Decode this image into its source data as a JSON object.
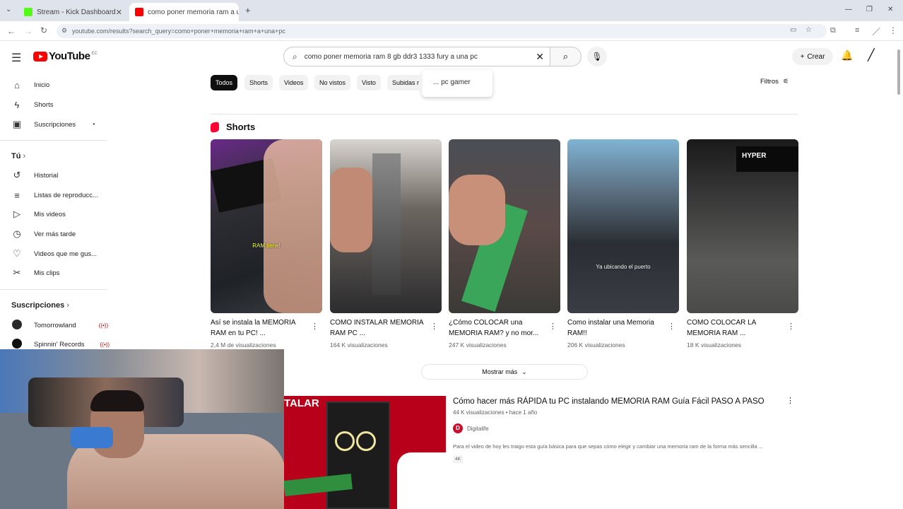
{
  "browser": {
    "tabs": [
      {
        "label": "Stream - Kick Dashboard",
        "active": false
      },
      {
        "label": "como poner memoria ram a u...",
        "active": true
      }
    ],
    "new_tab": "+",
    "url": "youtube.com/results?search_query=como+poner+memoria+ram+a+una+pc",
    "window_controls": {
      "minimize": "—",
      "restore": "❐",
      "close": "✕"
    }
  },
  "header": {
    "logo_text": "YouTube",
    "logo_country": "EC",
    "search_value": "como poner memoria ram 8 gb ddr3 1333 fury a una pc",
    "suggestion": "... pc gamer",
    "create_label": "Crear"
  },
  "sidebar": {
    "main": [
      {
        "label": "Inicio",
        "icon": "⌂",
        "name": "home-icon"
      },
      {
        "label": "Shorts",
        "icon": "ϟ",
        "name": "shorts-icon"
      },
      {
        "label": "Suscripciones",
        "icon": "▣",
        "name": "subscriptions-icon"
      }
    ],
    "you_title": "Tú",
    "you": [
      {
        "label": "Historial",
        "icon": "↺",
        "name": "history-icon"
      },
      {
        "label": "Listas de reproducc...",
        "icon": "≡",
        "name": "playlists-icon"
      },
      {
        "label": "Mis videos",
        "icon": "▷",
        "name": "my-videos-icon"
      },
      {
        "label": "Ver más tarde",
        "icon": "◷",
        "name": "watch-later-icon"
      },
      {
        "label": "Videos que me gus...",
        "icon": "👍",
        "name": "liked-icon"
      },
      {
        "label": "Mis clips",
        "icon": "✂",
        "name": "clips-icon"
      }
    ],
    "subs_title": "Suscripciones",
    "subs": [
      {
        "label": "Tomorrowland"
      },
      {
        "label": "Spinnin' Records"
      }
    ]
  },
  "chips": [
    "Todos",
    "Shorts",
    "Videos",
    "No vistos",
    "Visto",
    "Subidas r"
  ],
  "filters_label": "Filtros",
  "shorts": {
    "title": "Shorts",
    "items": [
      {
        "title": "Así se instala la MEMORIA RAM en tu PC! ...",
        "views": "2,4 M de visualizaciones",
        "overlay": "RAM tiene!",
        "color": "#3c3a3e"
      },
      {
        "title": "COMO INSTALAR MEMORIA RAM PC ...",
        "views": "164 K visualizaciones",
        "overlay": "",
        "color": "#5a5450"
      },
      {
        "title": "¿Cómo COLOCAR una MEMORIA RAM? y no mor...",
        "views": "247 K visualizaciones",
        "overlay": "",
        "color": "#4e4644"
      },
      {
        "title": "Como instalar una Memoria RAM!!",
        "views": "206 K visualizaciones",
        "overlay": "Ya ubicando el puerto",
        "color": "#4c5868"
      },
      {
        "title": "COMO COLOCAR LA MEMORIA RAM ...",
        "views": "18 K visualizaciones",
        "overlay": "",
        "color": "#3a3a3a"
      }
    ],
    "more_label": "Mostrar más"
  },
  "video": {
    "title": "Cómo hacer más RÁPIDA tu PC instalando MEMORIA RAM Guía Fácil PASO A PASO",
    "meta": "44 K visualizaciones • hace 1 año",
    "channel": "Digitalife",
    "channel_initial": "D",
    "description": "Para el video de hoy les traigo esta guía básica para que sepas cómo elegir y cambiar una memoria ram de la forma más sencilla ...",
    "badge": "4K",
    "thumb_text": "TALAR"
  }
}
